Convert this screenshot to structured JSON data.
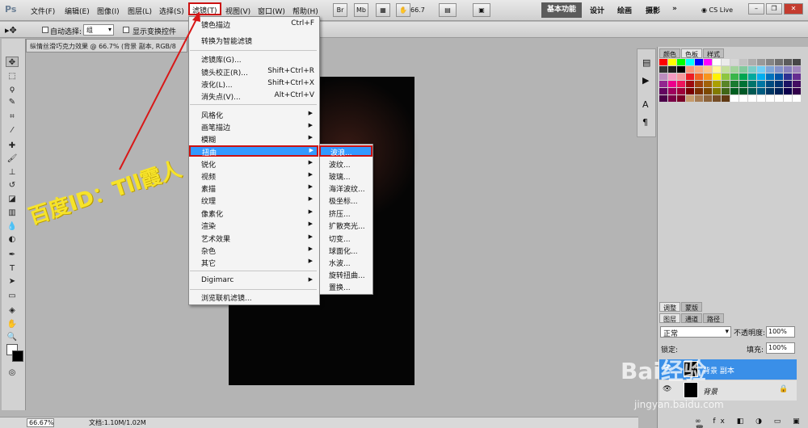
{
  "app": {
    "logo": "Ps"
  },
  "menubar": {
    "items": [
      "文件(F)",
      "编辑(E)",
      "图像(I)",
      "图层(L)",
      "选择(S)",
      "滤镜(T)",
      "视图(V)",
      "窗口(W)",
      "帮助(H)"
    ],
    "zoom_value": "66.7",
    "workspaces": [
      "基本功能",
      "设计",
      "绘画",
      "摄影"
    ],
    "more": "»",
    "cslive": "CS Live"
  },
  "options_bar": {
    "auto_select_label": "自动选择:",
    "auto_select_value": "组",
    "show_transform_label": "显示变换控件"
  },
  "document": {
    "tab_title": "纵情丝滑巧克力效果 @ 66.7% (背景 副本, RGB/8"
  },
  "filter_menu": {
    "items": [
      {
        "label": "镜色描边",
        "shortcut": "Ctrl+F"
      },
      {
        "label": "转换为智能滤镜",
        "shortcut": ""
      },
      {
        "label": "滤镜库(G)...",
        "shortcut": ""
      },
      {
        "label": "镜头校正(R)...",
        "shortcut": "Shift+Ctrl+R"
      },
      {
        "label": "液化(L)...",
        "shortcut": "Shift+Ctrl+X"
      },
      {
        "label": "消失点(V)...",
        "shortcut": "Alt+Ctrl+V"
      },
      {
        "label": "风格化",
        "shortcut": ""
      },
      {
        "label": "画笔描边",
        "shortcut": ""
      },
      {
        "label": "模糊",
        "shortcut": ""
      },
      {
        "label": "扭曲",
        "shortcut": ""
      },
      {
        "label": "锐化",
        "shortcut": ""
      },
      {
        "label": "视频",
        "shortcut": ""
      },
      {
        "label": "素描",
        "shortcut": ""
      },
      {
        "label": "纹理",
        "shortcut": ""
      },
      {
        "label": "像素化",
        "shortcut": ""
      },
      {
        "label": "渲染",
        "shortcut": ""
      },
      {
        "label": "艺术效果",
        "shortcut": ""
      },
      {
        "label": "杂色",
        "shortcut": ""
      },
      {
        "label": "其它",
        "shortcut": ""
      },
      {
        "label": "Digimarc",
        "shortcut": ""
      },
      {
        "label": "浏览联机滤镜...",
        "shortcut": ""
      }
    ]
  },
  "distort_submenu": {
    "items": [
      "波浪...",
      "波纹...",
      "玻璃...",
      "海洋波纹...",
      "极坐标...",
      "挤压...",
      "扩散亮光...",
      "切变...",
      "球面化...",
      "水波...",
      "旋转扭曲...",
      "置换..."
    ]
  },
  "right_panel": {
    "top_tabs": [
      "颜色",
      "色板",
      "样式"
    ],
    "mid_tabs": [
      "调整",
      "蒙版"
    ],
    "layer_tabs": [
      "图层",
      "通道",
      "路径"
    ],
    "blend_mode": "正常",
    "opacity_label": "不透明度:",
    "opacity_value": "100%",
    "lock_label": "锁定:",
    "fill_label": "填充:",
    "fill_value": "100%",
    "layers": [
      "背景 副本",
      "背景"
    ],
    "swatch_colors": [
      "#ff0000",
      "#ffff00",
      "#00ff00",
      "#00ffff",
      "#0000ff",
      "#ff00ff",
      "#ffffff",
      "#ebebeb",
      "#d6d6d6",
      "#c2c2c2",
      "#adadad",
      "#999999",
      "#858585",
      "#707070",
      "#5c5c5c",
      "#474747",
      "#333333",
      "#1f1f1f",
      "#000000",
      "#f7977a",
      "#f9ad81",
      "#fdc68a",
      "#fff79a",
      "#c4df9b",
      "#a2d39c",
      "#82ca9d",
      "#7bcdc8",
      "#6ecff6",
      "#7ea7d8",
      "#8493ca",
      "#8882be",
      "#a187be",
      "#bc8dbf",
      "#f49ac2",
      "#f6989d",
      "#ed1c24",
      "#f26522",
      "#f7941d",
      "#fff200",
      "#8dc63f",
      "#39b54a",
      "#00a651",
      "#00a99d",
      "#00aeef",
      "#0072bc",
      "#0054a6",
      "#2e3192",
      "#662d91",
      "#92278f",
      "#ec008c",
      "#ed145b",
      "#9e0b0f",
      "#a0410d",
      "#a36209",
      "#aba000",
      "#598527",
      "#1a7b30",
      "#007236",
      "#00746b",
      "#0076a3",
      "#004b80",
      "#003471",
      "#1b1464",
      "#440e62",
      "#630460",
      "#9e005d",
      "#9e0039",
      "#790000",
      "#7b2e00",
      "#7d4900",
      "#827b00",
      "#406618",
      "#005e20",
      "#005826",
      "#005952",
      "#005b7f",
      "#003663",
      "#002157",
      "#0d004c",
      "#32004b",
      "#4b0049",
      "#7b0046",
      "#7a0026",
      "#c69c6d",
      "#a67c52",
      "#8c6239",
      "#754c24",
      "#603913",
      "#ffffff",
      "#ffffff",
      "#ffffff",
      "#ffffff",
      "#ffffff",
      "#ffffff",
      "#ffffff",
      "#ffffff"
    ]
  },
  "status_bar": {
    "zoom": "66.67%",
    "doc_info": "文档:1.10M/1.02M"
  },
  "watermarks": {
    "user": "百度ID：Tll霞人",
    "brand": "Bai经验",
    "url": "jingyan.baidu.com"
  }
}
